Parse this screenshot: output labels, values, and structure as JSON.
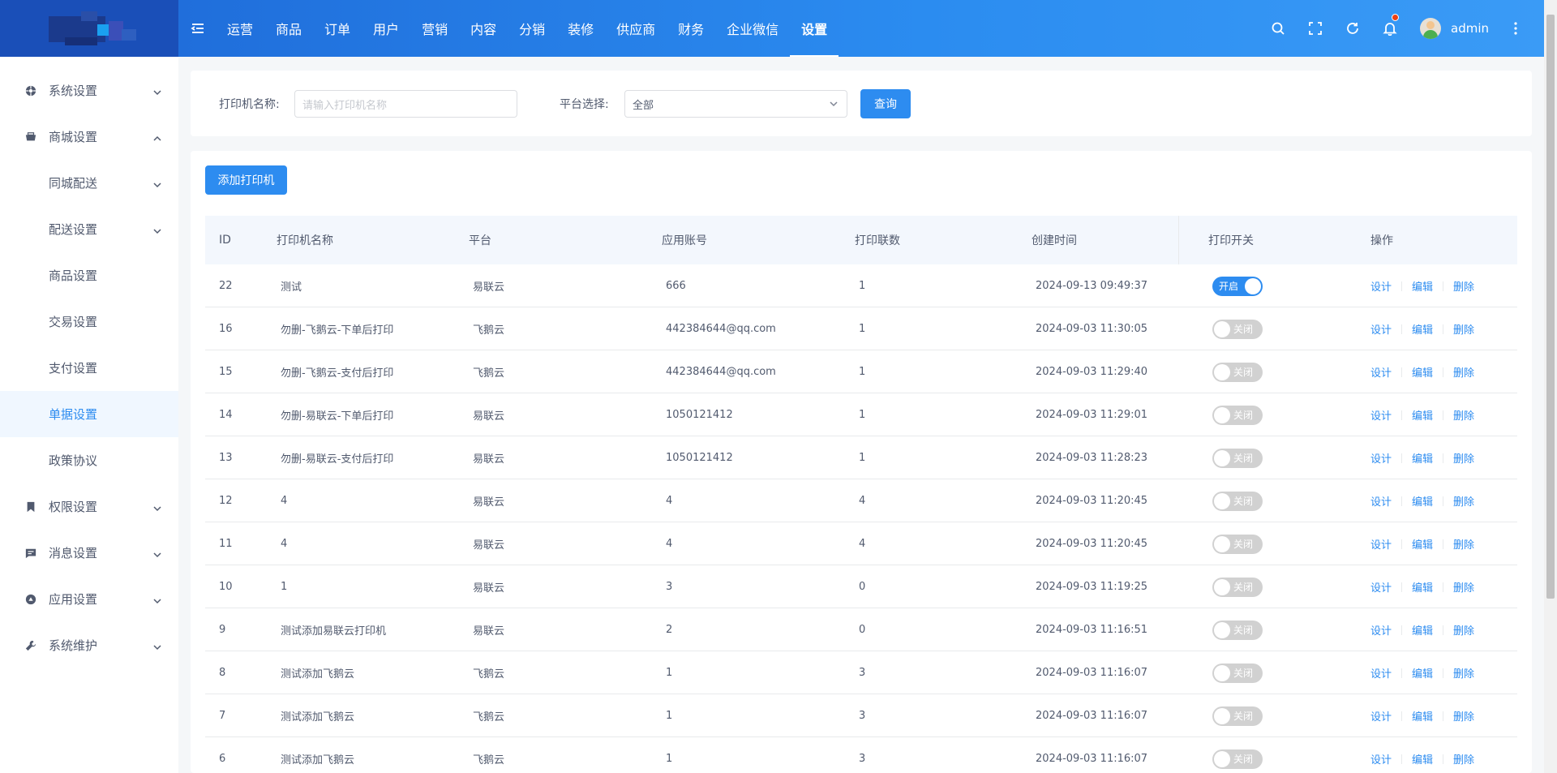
{
  "header": {
    "nav": [
      "运营",
      "商品",
      "订单",
      "用户",
      "营销",
      "内容",
      "分销",
      "装修",
      "供应商",
      "财务",
      "企业微信",
      "设置"
    ],
    "active_nav": "设置",
    "username": "admin"
  },
  "sidebar": {
    "items": [
      {
        "label": "系统设置",
        "icon": "gear-icon",
        "arrow": "down",
        "level": 1
      },
      {
        "label": "商城设置",
        "icon": "shop-icon",
        "arrow": "up",
        "level": 1
      },
      {
        "label": "同城配送",
        "arrow": "down",
        "level": 2
      },
      {
        "label": "配送设置",
        "arrow": "down",
        "level": 2
      },
      {
        "label": "商品设置",
        "level": 2
      },
      {
        "label": "交易设置",
        "level": 2
      },
      {
        "label": "支付设置",
        "level": 2
      },
      {
        "label": "单据设置",
        "level": 2,
        "active": true
      },
      {
        "label": "政策协议",
        "level": 2
      },
      {
        "label": "权限设置",
        "icon": "bookmark-icon",
        "arrow": "down",
        "level": 1
      },
      {
        "label": "消息设置",
        "icon": "message-icon",
        "arrow": "down",
        "level": 1
      },
      {
        "label": "应用设置",
        "icon": "app-icon",
        "arrow": "down",
        "level": 1
      },
      {
        "label": "系统维护",
        "icon": "wrench-icon",
        "arrow": "down",
        "level": 1
      }
    ]
  },
  "search": {
    "name_label": "打印机名称:",
    "name_placeholder": "请输入打印机名称",
    "platform_label": "平台选择:",
    "platform_value": "全部",
    "query_button": "查询"
  },
  "toolbar": {
    "add_button": "添加打印机"
  },
  "table": {
    "columns": [
      "ID",
      "打印机名称",
      "平台",
      "应用账号",
      "打印联数",
      "创建时间",
      "打印开关",
      "操作"
    ],
    "switch_on_label": "开启",
    "switch_off_label": "关闭",
    "actions": [
      "设计",
      "编辑",
      "删除"
    ],
    "rows": [
      {
        "id": "22",
        "name": "测试",
        "platform": "易联云",
        "account": "666",
        "copies": "1",
        "created": "2024-09-13 09:49:37",
        "on": true
      },
      {
        "id": "16",
        "name": "勿删-飞鹅云-下单后打印",
        "platform": "飞鹅云",
        "account": "442384644@qq.com",
        "copies": "1",
        "created": "2024-09-03 11:30:05",
        "on": false
      },
      {
        "id": "15",
        "name": "勿删-飞鹅云-支付后打印",
        "platform": "飞鹅云",
        "account": "442384644@qq.com",
        "copies": "1",
        "created": "2024-09-03 11:29:40",
        "on": false
      },
      {
        "id": "14",
        "name": "勿删-易联云-下单后打印",
        "platform": "易联云",
        "account": "1050121412",
        "copies": "1",
        "created": "2024-09-03 11:29:01",
        "on": false
      },
      {
        "id": "13",
        "name": "勿删-易联云-支付后打印",
        "platform": "易联云",
        "account": "1050121412",
        "copies": "1",
        "created": "2024-09-03 11:28:23",
        "on": false
      },
      {
        "id": "12",
        "name": "4",
        "platform": "易联云",
        "account": "4",
        "copies": "4",
        "created": "2024-09-03 11:20:45",
        "on": false
      },
      {
        "id": "11",
        "name": "4",
        "platform": "易联云",
        "account": "4",
        "copies": "4",
        "created": "2024-09-03 11:20:45",
        "on": false
      },
      {
        "id": "10",
        "name": "1",
        "platform": "易联云",
        "account": "3",
        "copies": "0",
        "created": "2024-09-03 11:19:25",
        "on": false
      },
      {
        "id": "9",
        "name": "测试添加易联云打印机",
        "platform": "易联云",
        "account": "2",
        "copies": "0",
        "created": "2024-09-03 11:16:51",
        "on": false
      },
      {
        "id": "8",
        "name": "测试添加飞鹅云",
        "platform": "飞鹅云",
        "account": "1",
        "copies": "3",
        "created": "2024-09-03 11:16:07",
        "on": false
      },
      {
        "id": "7",
        "name": "测试添加飞鹅云",
        "platform": "飞鹅云",
        "account": "1",
        "copies": "3",
        "created": "2024-09-03 11:16:07",
        "on": false
      },
      {
        "id": "6",
        "name": "测试添加飞鹅云",
        "platform": "飞鹅云",
        "account": "1",
        "copies": "3",
        "created": "2024-09-03 11:16:07",
        "on": false
      }
    ]
  },
  "colors": {
    "primary": "#2d8cf0",
    "header_start": "#1d67d6",
    "header_end": "#3a9bf6",
    "switch_off": "#d1d1d1",
    "notification": "#ed4014"
  }
}
